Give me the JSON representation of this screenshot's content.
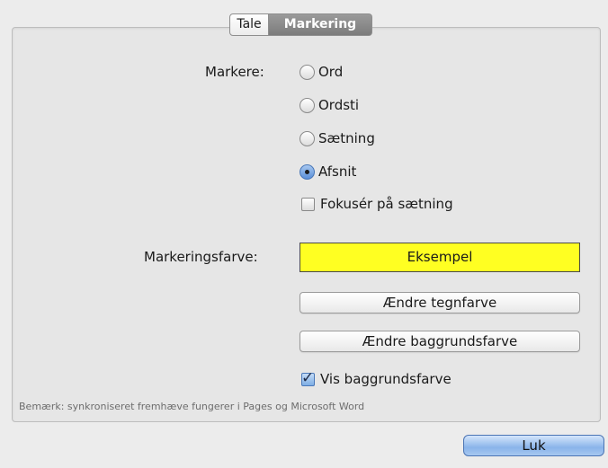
{
  "tabs": {
    "tale": "Tale",
    "markering": "Markering",
    "active": "Markering"
  },
  "markere": {
    "label": "Markere:",
    "options": [
      {
        "label": "Ord",
        "selected": false
      },
      {
        "label": "Ordsti",
        "selected": false
      },
      {
        "label": "Sætning",
        "selected": false
      },
      {
        "label": "Afsnit",
        "selected": true
      }
    ],
    "focus_checkbox": {
      "label": "Fokusér på sætning",
      "checked": false
    }
  },
  "markeringsfarve": {
    "label": "Markeringsfarve:",
    "sample": "Eksempel",
    "sample_color": "#ffff22",
    "change_text_color_button": "Ændre tegnfarve",
    "change_background_color_button": "Ændre baggrundsfarve",
    "show_background_checkbox": {
      "label": "Vis baggrundsfarve",
      "checked": true
    }
  },
  "note": "Bemærk: synkroniseret fremhæve fungerer i Pages og Microsoft Word",
  "close_button": "Luk"
}
